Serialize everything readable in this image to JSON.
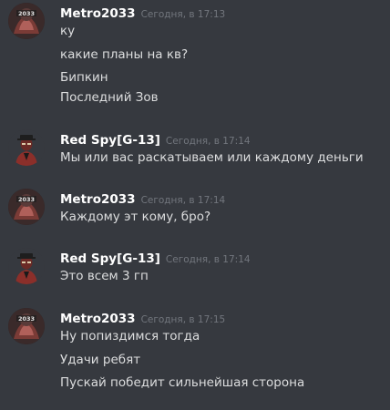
{
  "messages": [
    {
      "author": "Metro2033",
      "timestamp": "Сегодня, в 17:13",
      "avatar_icon": "metro-avatar-icon",
      "lines": [
        "ку",
        "какие планы на кв?",
        "Бипкин",
        "Последний Зов"
      ]
    },
    {
      "author": "Red Spy[G-13]",
      "timestamp": "Сегодня, в 17:14",
      "avatar_icon": "spy-avatar-icon",
      "lines": [
        "Мы или вас раскатываем или каждому деньги"
      ]
    },
    {
      "author": "Metro2033",
      "timestamp": "Сегодня, в 17:14",
      "avatar_icon": "metro-avatar-icon",
      "lines": [
        "Каждому эт кому, бро?"
      ]
    },
    {
      "author": "Red Spy[G-13]",
      "timestamp": "Сегодня, в 17:14",
      "avatar_icon": "spy-avatar-icon",
      "lines": [
        "Это всем 3 гп"
      ]
    },
    {
      "author": "Metro2033",
      "timestamp": "Сегодня, в 17:15",
      "avatar_icon": "metro-avatar-icon",
      "lines": [
        "Ну попиздимся тогда",
        "Удачи ребят",
        "Пускай победит сильнейшая сторона"
      ]
    }
  ],
  "avatar_text": "2033",
  "colors": {
    "background": "#36393f",
    "username": "#ffffff",
    "timestamp": "#72767d",
    "text": "#dcddde"
  }
}
